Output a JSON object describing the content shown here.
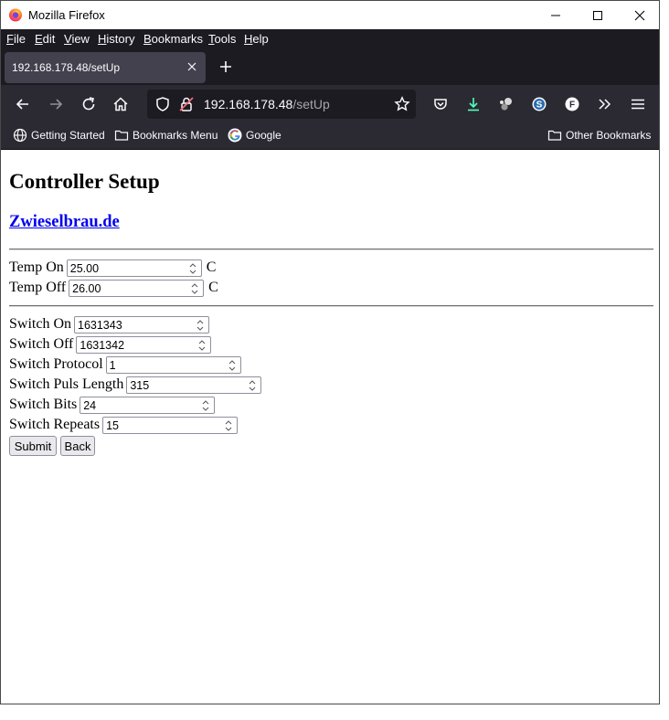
{
  "window": {
    "title": "Mozilla Firefox"
  },
  "menubar": {
    "items": [
      {
        "label": "File"
      },
      {
        "label": "Edit"
      },
      {
        "label": "View"
      },
      {
        "label": "History"
      },
      {
        "label": "Bookmarks"
      },
      {
        "label": "Tools"
      },
      {
        "label": "Help"
      }
    ]
  },
  "tab": {
    "title": "192.168.178.48/setUp"
  },
  "urlbar": {
    "host": "192.168.178.48",
    "path": "/setUp"
  },
  "bookmarks": {
    "items": [
      {
        "label": "Getting Started",
        "icon": "globe-icon"
      },
      {
        "label": "Bookmarks Menu",
        "icon": "folder-icon"
      },
      {
        "label": "Google",
        "icon": "google-icon"
      }
    ],
    "other": "Other Bookmarks"
  },
  "page": {
    "heading": "Controller Setup",
    "link": "Zwieselbrau.de",
    "temp_fields": [
      {
        "label": "Temp On",
        "value": "25.00",
        "unit": "C"
      },
      {
        "label": "Temp Off",
        "value": "26.00",
        "unit": "C"
      }
    ],
    "switch_fields": [
      {
        "label": "Switch On",
        "value": "1631343"
      },
      {
        "label": "Switch Off",
        "value": "1631342"
      },
      {
        "label": "Switch Protocol",
        "value": "1"
      },
      {
        "label": "Switch Puls Length",
        "value": "315"
      },
      {
        "label": "Switch Bits",
        "value": "24"
      },
      {
        "label": "Switch Repeats",
        "value": "15"
      }
    ],
    "submit_label": "Submit",
    "back_label": "Back"
  },
  "colors": {
    "toolbar_dark": "#2b2a33",
    "tabbar_dark": "#1c1b22",
    "link": "#0000ee",
    "download_accent": "#54ffbd"
  }
}
